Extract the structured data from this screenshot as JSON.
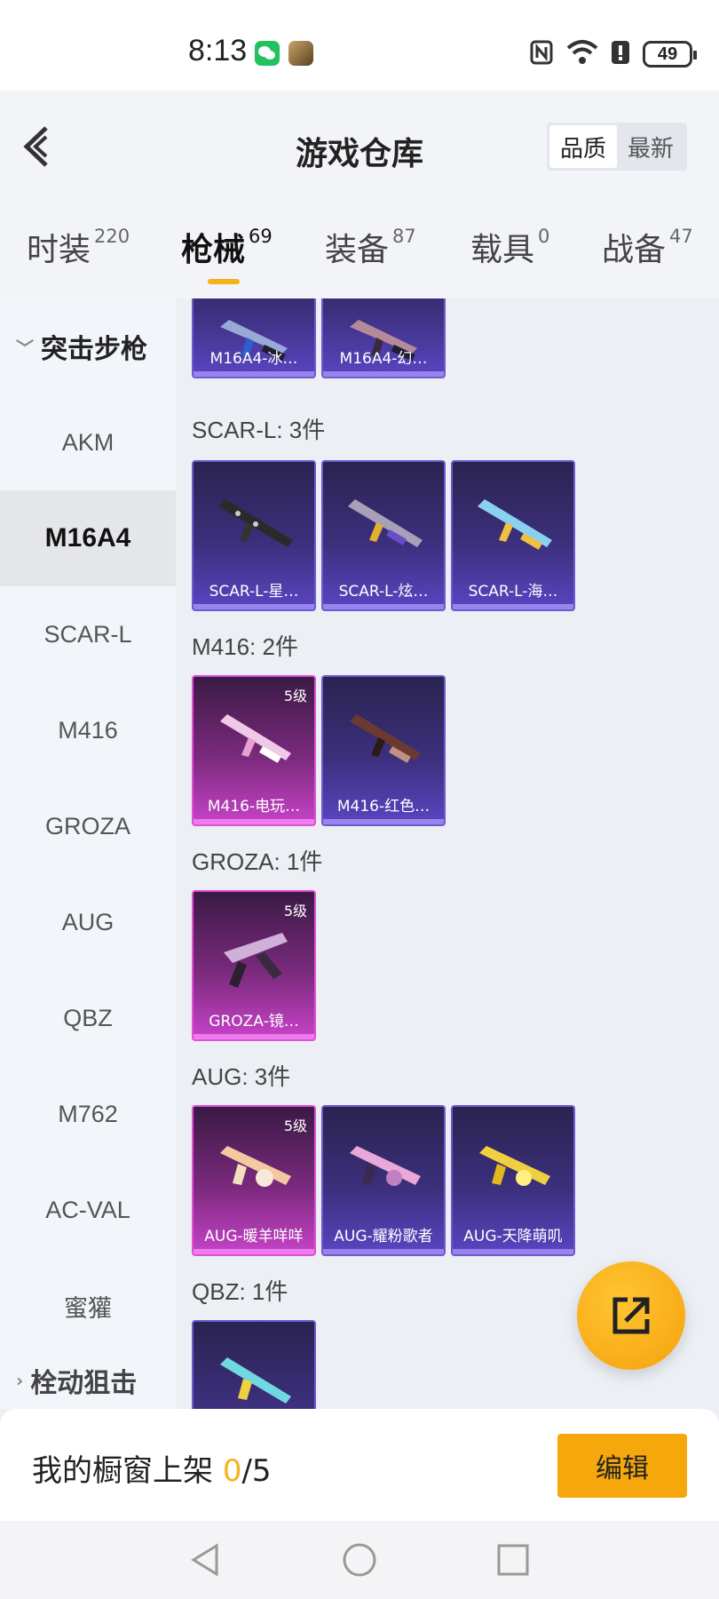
{
  "status_bar": {
    "time": "8:13",
    "battery": "49"
  },
  "header": {
    "title": "游戏仓库",
    "sort_quality": "品质",
    "sort_newest": "最新"
  },
  "tabs": [
    {
      "label": "时装",
      "count": "220"
    },
    {
      "label": "枪械",
      "count": "69"
    },
    {
      "label": "装备",
      "count": "87"
    },
    {
      "label": "载具",
      "count": "0"
    },
    {
      "label": "战备",
      "count": "47"
    }
  ],
  "sidebar": {
    "category": "突击步枪",
    "items": [
      "AKM",
      "M16A4",
      "SCAR-L",
      "M416",
      "GROZA",
      "AUG",
      "QBZ",
      "M762",
      "AC-VAL",
      "蜜獾"
    ],
    "next_category": "栓动狙击"
  },
  "groups": [
    {
      "label": "",
      "items": [
        {
          "name": "M16A4-冰…",
          "level": ""
        },
        {
          "name": "M16A4-幻…",
          "level": ""
        }
      ]
    },
    {
      "label": "SCAR-L: 3件",
      "items": [
        {
          "name": "SCAR-L-星…",
          "level": ""
        },
        {
          "name": "SCAR-L-炫…",
          "level": ""
        },
        {
          "name": "SCAR-L-海…",
          "level": ""
        }
      ]
    },
    {
      "label": "M416: 2件",
      "items": [
        {
          "name": "M416-电玩…",
          "level": "5级"
        },
        {
          "name": "M416-红色…",
          "level": ""
        }
      ]
    },
    {
      "label": "GROZA: 1件",
      "items": [
        {
          "name": "GROZA-镜…",
          "level": "5级"
        }
      ]
    },
    {
      "label": "AUG: 3件",
      "items": [
        {
          "name": "AUG-暖羊咩咩",
          "level": "5级"
        },
        {
          "name": "AUG-耀粉歌者",
          "level": ""
        },
        {
          "name": "AUG-天降萌叽",
          "level": ""
        }
      ]
    },
    {
      "label": "QBZ: 1件",
      "items": [
        {
          "name": "",
          "level": ""
        }
      ]
    }
  ],
  "showcase": {
    "label": "我的橱窗上架",
    "current": "0",
    "total": "/5",
    "edit": "编辑"
  },
  "colors": {
    "accent": "#f5a70c",
    "purple_card": "#3c2f7c",
    "pink_card": "#c843c8"
  }
}
